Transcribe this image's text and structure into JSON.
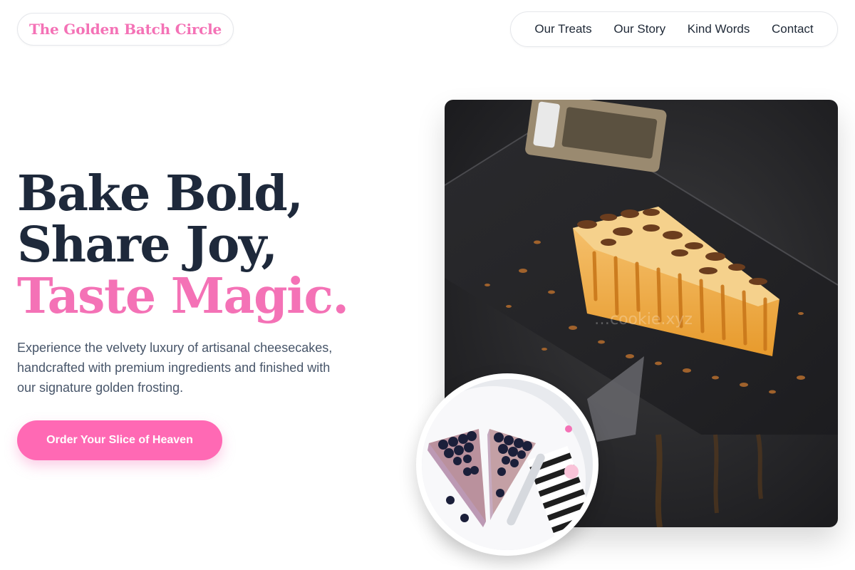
{
  "brand": {
    "name": "The Golden Batch Circle"
  },
  "nav": {
    "items": [
      {
        "label": "Our Treats"
      },
      {
        "label": "Our Story"
      },
      {
        "label": "Kind Words"
      },
      {
        "label": "Contact"
      }
    ]
  },
  "hero": {
    "title_line1": "Bake Bold,",
    "title_line2": "Share Joy,",
    "title_line3": "Taste Magic.",
    "description": "Experience the velvety luxury of artisanal cheesecakes, handcrafted with premium ingredients and finished with our signature golden frosting.",
    "cta_label": "Order Your Slice of Heaven"
  },
  "images": {
    "main_alt": "cheesecake-slice-with-chocolate-shavings",
    "watermark": "…cookie.xyz",
    "inset_alt": "blueberry-cheesecake-slices"
  },
  "colors": {
    "accent": "#ff69b4",
    "accent_text": "#f472b6",
    "heading": "#1e293b",
    "body_text": "#475569"
  }
}
